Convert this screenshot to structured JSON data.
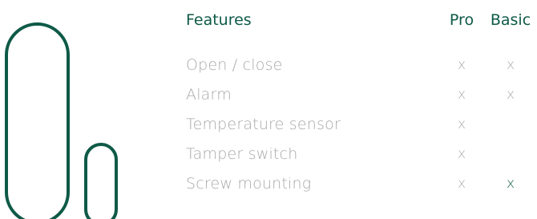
{
  "header": {
    "features": "Features",
    "pro": "Pro",
    "basic": "Basic"
  },
  "rows": [
    {
      "feature": "Open / close",
      "pro": "x",
      "basic": "x",
      "basic_highlight": false
    },
    {
      "feature": "Alarm",
      "pro": "x",
      "basic": "x",
      "basic_highlight": false
    },
    {
      "feature": "Temperature sensor",
      "pro": "x",
      "basic": "",
      "basic_highlight": false
    },
    {
      "feature": "Tamper switch",
      "pro": "x",
      "basic": "",
      "basic_highlight": false
    },
    {
      "feature": "Screw mounting",
      "pro": "x",
      "basic": "x",
      "basic_highlight": true
    }
  ],
  "colors": {
    "brand_green": "#0e5a47",
    "muted_gray": "#a9a9a9",
    "background": "#ffffff"
  },
  "illustration": {
    "large_part": "sensor-body-icon",
    "small_part": "magnet-icon"
  }
}
